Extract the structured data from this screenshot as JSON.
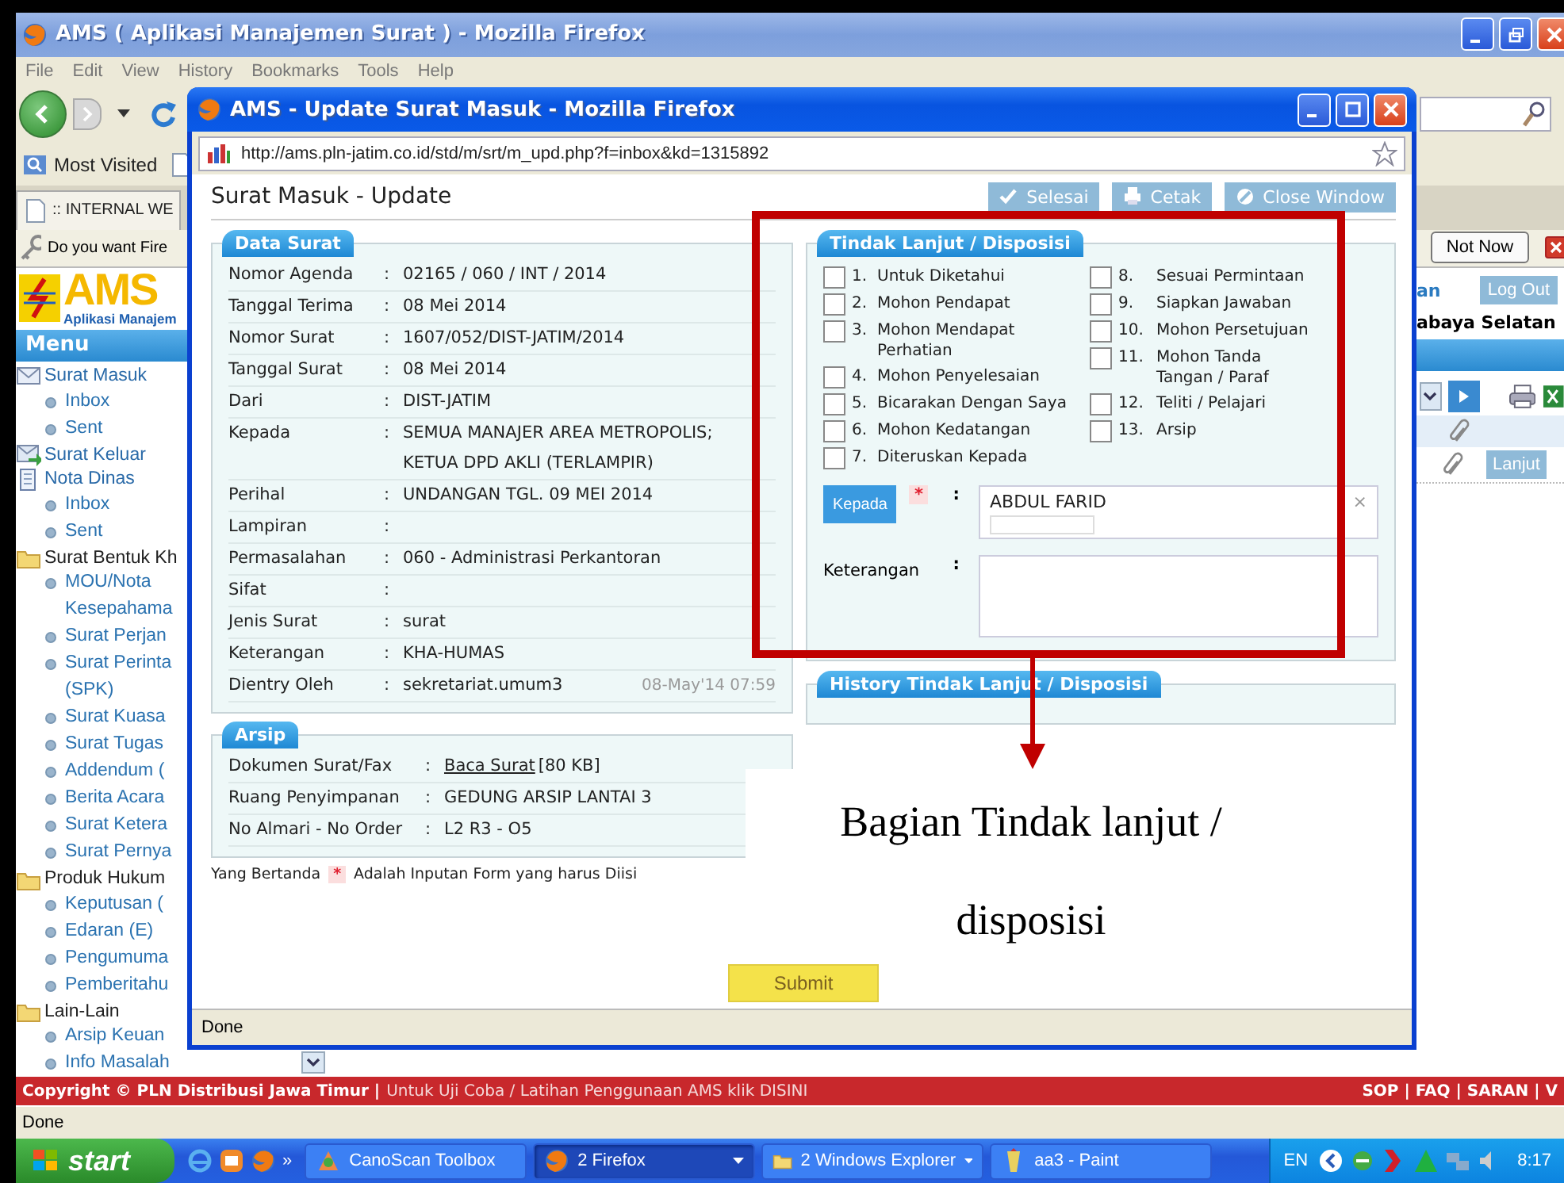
{
  "browser": {
    "title": "AMS ( Aplikasi Manajemen Surat ) - Mozilla Firefox",
    "menu": [
      "File",
      "Edit",
      "View",
      "History",
      "Bookmarks",
      "Tools",
      "Help"
    ],
    "bookmarks": [
      "Most Visited"
    ],
    "tab": ":: INTERNAL WE",
    "notification": {
      "text": "Do you want Fire",
      "button": "Not Now"
    },
    "logo": {
      "title": "AMS",
      "subtitle": "Aplikasi Manajem"
    },
    "menu_title": "Menu",
    "sidebar": [
      {
        "label": "Surat Masuk",
        "kind": "inbox",
        "children": [
          {
            "label": "Inbox"
          },
          {
            "label": "Sent"
          }
        ]
      },
      {
        "label": "Surat Keluar",
        "kind": "outbox"
      },
      {
        "label": "Nota Dinas",
        "kind": "note",
        "children": [
          {
            "label": "Inbox"
          },
          {
            "label": "Sent"
          }
        ]
      },
      {
        "label": "Surat Bentuk Kh",
        "kind": "folder",
        "children": [
          {
            "label": "MOU/Nota Kesepahama"
          },
          {
            "label": "Surat Perjan"
          },
          {
            "label": "Surat Perinta (SPK)"
          },
          {
            "label": "Surat Kuasa"
          },
          {
            "label": "Surat Tugas"
          },
          {
            "label": "Addendum ("
          },
          {
            "label": "Berita Acara"
          },
          {
            "label": "Surat Ketera"
          },
          {
            "label": "Surat Pernya"
          }
        ]
      },
      {
        "label": "Produk Hukum",
        "kind": "folder",
        "children": [
          {
            "label": "Keputusan ("
          },
          {
            "label": "Edaran (E)"
          },
          {
            "label": "Pengumuma"
          },
          {
            "label": "Pemberitahu"
          }
        ]
      },
      {
        "label": "Lain-Lain",
        "kind": "folder",
        "children": [
          {
            "label": "Arsip Keuan"
          },
          {
            "label": "Info Masalah"
          }
        ]
      }
    ],
    "side_panel": {
      "label": "an",
      "button": "Log Out",
      "unit": "abaya Selatan",
      "row_action": "Lanjut"
    },
    "footer": {
      "copyright": "Copyright © PLN Distribusi Jawa Timur |",
      "note": "Untuk Uji Coba / Latihan Penggunaan AMS klik DISINI",
      "links": "SOP | FAQ | SARAN | V"
    },
    "status": "Done"
  },
  "popup": {
    "title": "AMS - Update Surat Masuk - Mozilla Firefox",
    "url": "http://ams.pln-jatim.co.id/std/m/srt/m_upd.php?f=inbox&kd=1315892",
    "heading": "Surat Masuk - Update",
    "actions": [
      {
        "label": "Selesai",
        "kind": "done"
      },
      {
        "label": "Cetak",
        "kind": "print"
      },
      {
        "label": "Close Window",
        "kind": "close"
      }
    ],
    "data_surat": {
      "legend": "Data Surat",
      "rows": [
        {
          "label": "Nomor Agenda",
          "sep": ":",
          "value": "02165 / 060 / INT / 2014"
        },
        {
          "label": "Tanggal Terima",
          "sep": ":",
          "value": "08 Mei 2014"
        },
        {
          "label": "Nomor Surat",
          "sep": ":",
          "value": "1607/052/DIST-JATIM/2014"
        },
        {
          "label": "Tanggal Surat",
          "sep": ":",
          "value": "08 Mei 2014"
        },
        {
          "label": "Dari",
          "sep": ":",
          "value": "DIST-JATIM"
        },
        {
          "label": "Kepada",
          "sep": ":",
          "value": "SEMUA MANAJER AREA METROPOLIS; KETUA DPD AKLI (TERLAMPIR)"
        },
        {
          "label": "Perihal",
          "sep": ":",
          "value": "UNDANGAN TGL. 09 MEI 2014"
        },
        {
          "label": "Lampiran",
          "sep": ":"
        },
        {
          "label": "Permasalahan",
          "sep": ":",
          "value": "060 - Administrasi Perkantoran"
        },
        {
          "label": "Sifat",
          "sep": ":"
        },
        {
          "label": "Jenis Surat",
          "sep": ":",
          "value": "surat"
        },
        {
          "label": "Keterangan",
          "sep": ":",
          "value": "KHA-HUMAS"
        },
        {
          "label": "Dientry Oleh",
          "sep": ":",
          "value": "sekretariat.umum3",
          "stamp": "08-May'14 07:59"
        }
      ]
    },
    "arsip": {
      "legend": "Arsip",
      "rows": [
        {
          "label": "Dokumen Surat/Fax",
          "sep": ":",
          "link": "Baca Surat",
          "value": "[80 KB]"
        },
        {
          "label": "Ruang Penyimpanan",
          "sep": ":",
          "value": "GEDUNG ARSIP LANTAI 3"
        },
        {
          "label": "No Almari - No Order",
          "sep": ":",
          "value": "L2 R3 - O5"
        }
      ]
    },
    "note": {
      "before": "Yang Bertanda",
      "mark": "*",
      "after": "Adalah Inputan Form yang harus Diisi"
    },
    "disposition": {
      "legend": "Tindak Lanjut / Disposisi",
      "columns": [
        {
          "items": [
            {
              "number": "1.",
              "label": "Untuk Diketahui",
              "checked": false
            },
            {
              "number": "2.",
              "label": "Mohon Pendapat",
              "checked": false
            },
            {
              "number": "3.",
              "label": "Mohon Mendapat Perhatian",
              "checked": false
            },
            {
              "number": "4.",
              "label": "Mohon Penyelesaian",
              "checked": false
            },
            {
              "number": "5.",
              "label": "Bicarakan Dengan Saya",
              "checked": false
            },
            {
              "number": "6.",
              "label": "Mohon Kedatangan",
              "checked": false
            },
            {
              "number": "7.",
              "label": "Diteruskan Kepada",
              "checked": false
            }
          ]
        },
        {
          "items": [
            {
              "number": "8.",
              "label": "Sesuai Permintaan",
              "checked": false
            },
            {
              "number": "9.",
              "label": "Siapkan Jawaban",
              "checked": false
            },
            {
              "number": "10.",
              "label": "Mohon Persetujuan",
              "checked": false
            },
            {
              "number": "11.",
              "label": "Mohon Tanda Tangan / Paraf",
              "checked": false
            },
            {
              "number": "12.",
              "label": "Teliti / Pelajari",
              "checked": false
            },
            {
              "number": "13.",
              "label": "Arsip",
              "checked": false
            }
          ]
        }
      ],
      "recipient": {
        "button": "Kepada",
        "mark": "*",
        "sep": ":",
        "value": "ABDUL FARID",
        "remove": "×"
      },
      "remarks": {
        "label": "Keterangan",
        "sep": ":"
      }
    },
    "history": {
      "legend": "History Tindak Lanjut / Disposisi"
    },
    "submit": "Submit",
    "status": "Done"
  },
  "annotation": {
    "caption": [
      "Bagian Tindak lanjut /",
      "disposisi"
    ]
  },
  "taskbar": {
    "start": "start",
    "more": "»",
    "buttons": [
      {
        "label": "CanoScan Toolbox",
        "kind": "scanner",
        "grouped": false,
        "selected": false
      },
      {
        "label": "2 Firefox",
        "kind": "browser",
        "grouped": true,
        "selected": true
      },
      {
        "label": "2 Windows Explorer",
        "kind": "folder",
        "grouped": true,
        "selected": false
      },
      {
        "label": "aa3 - Paint",
        "kind": "paint",
        "grouped": false,
        "selected": false
      }
    ],
    "tray": {
      "language": "EN",
      "clock": "8:17"
    }
  }
}
